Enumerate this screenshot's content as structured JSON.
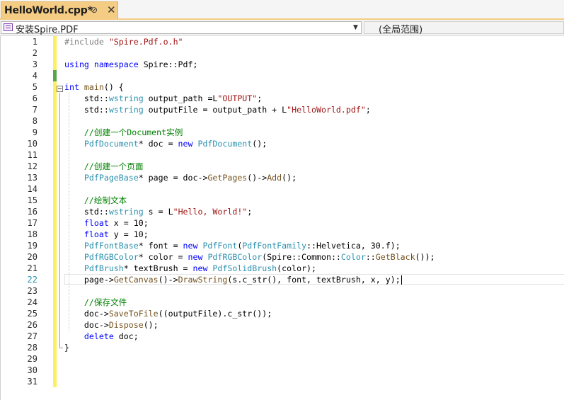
{
  "tab": {
    "title": "HelloWorld.cpp*",
    "pin_icon": "pin-icon",
    "close_icon": "close-icon"
  },
  "navbar": {
    "scope": "安装Spire.PDF",
    "member": "(全局范围)"
  },
  "editor": {
    "current_line": 22,
    "line_numbers": [
      "1",
      "2",
      "3",
      "4",
      "5",
      "6",
      "7",
      "8",
      "9",
      "10",
      "11",
      "12",
      "13",
      "14",
      "15",
      "16",
      "17",
      "18",
      "19",
      "20",
      "21",
      "22",
      "23",
      "24",
      "25",
      "26",
      "27",
      "28",
      "29",
      "30",
      "31"
    ],
    "lines": [
      [
        {
          "t": "#include ",
          "c": "pp"
        },
        {
          "t": "\"Spire.Pdf.o.h\"",
          "c": "str"
        }
      ],
      [],
      [
        {
          "t": "using namespace ",
          "c": "kw"
        },
        {
          "t": "Spire::Pdf;",
          "c": ""
        }
      ],
      [],
      [
        {
          "t": "int ",
          "c": "kw"
        },
        {
          "t": "main",
          "c": "fn"
        },
        {
          "t": "() {",
          "c": ""
        }
      ],
      [
        {
          "t": "    std::",
          "c": ""
        },
        {
          "t": "wstring",
          "c": "ty"
        },
        {
          "t": " output_path =L",
          "c": ""
        },
        {
          "t": "\"OUTPUT\"",
          "c": "str"
        },
        {
          "t": ";",
          "c": ""
        }
      ],
      [
        {
          "t": "    std::",
          "c": ""
        },
        {
          "t": "wstring",
          "c": "ty"
        },
        {
          "t": " outputFile = output_path + L",
          "c": ""
        },
        {
          "t": "\"HelloWorld.pdf\"",
          "c": "str"
        },
        {
          "t": ";",
          "c": ""
        }
      ],
      [],
      [
        {
          "t": "    //创建一个Document实例",
          "c": "cm"
        }
      ],
      [
        {
          "t": "    ",
          "c": ""
        },
        {
          "t": "PdfDocument",
          "c": "ty"
        },
        {
          "t": "* doc = ",
          "c": ""
        },
        {
          "t": "new ",
          "c": "kw"
        },
        {
          "t": "PdfDocument",
          "c": "ty"
        },
        {
          "t": "();",
          "c": ""
        }
      ],
      [],
      [
        {
          "t": "    //创建一个页面",
          "c": "cm"
        }
      ],
      [
        {
          "t": "    ",
          "c": ""
        },
        {
          "t": "PdfPageBase",
          "c": "ty"
        },
        {
          "t": "* page = doc->",
          "c": ""
        },
        {
          "t": "GetPages",
          "c": "fn"
        },
        {
          "t": "()->",
          "c": ""
        },
        {
          "t": "Add",
          "c": "fn"
        },
        {
          "t": "();",
          "c": ""
        }
      ],
      [],
      [
        {
          "t": "    //绘制文本",
          "c": "cm"
        }
      ],
      [
        {
          "t": "    std::",
          "c": ""
        },
        {
          "t": "wstring",
          "c": "ty"
        },
        {
          "t": " s = L",
          "c": ""
        },
        {
          "t": "\"Hello, World!\"",
          "c": "str"
        },
        {
          "t": ";",
          "c": ""
        }
      ],
      [
        {
          "t": "    ",
          "c": ""
        },
        {
          "t": "float",
          "c": "kw"
        },
        {
          "t": " x = 10;",
          "c": ""
        }
      ],
      [
        {
          "t": "    ",
          "c": ""
        },
        {
          "t": "float",
          "c": "kw"
        },
        {
          "t": " y = 10;",
          "c": ""
        }
      ],
      [
        {
          "t": "    ",
          "c": ""
        },
        {
          "t": "PdfFontBase",
          "c": "ty"
        },
        {
          "t": "* font = ",
          "c": ""
        },
        {
          "t": "new ",
          "c": "kw"
        },
        {
          "t": "PdfFont",
          "c": "ty"
        },
        {
          "t": "(",
          "c": ""
        },
        {
          "t": "PdfFontFamily",
          "c": "ty"
        },
        {
          "t": "::Helvetica, 30.f);",
          "c": ""
        }
      ],
      [
        {
          "t": "    ",
          "c": ""
        },
        {
          "t": "PdfRGBColor",
          "c": "ty"
        },
        {
          "t": "* color = ",
          "c": ""
        },
        {
          "t": "new ",
          "c": "kw"
        },
        {
          "t": "PdfRGBColor",
          "c": "ty"
        },
        {
          "t": "(Spire::Common::",
          "c": ""
        },
        {
          "t": "Color",
          "c": "ty"
        },
        {
          "t": "::",
          "c": ""
        },
        {
          "t": "GetBlack",
          "c": "fn"
        },
        {
          "t": "());",
          "c": ""
        }
      ],
      [
        {
          "t": "    ",
          "c": ""
        },
        {
          "t": "PdfBrush",
          "c": "ty"
        },
        {
          "t": "* textBrush = ",
          "c": ""
        },
        {
          "t": "new ",
          "c": "kw"
        },
        {
          "t": "PdfSolidBrush",
          "c": "ty"
        },
        {
          "t": "(color);",
          "c": ""
        }
      ],
      [
        {
          "t": "    page->",
          "c": ""
        },
        {
          "t": "GetCanvas",
          "c": "fn"
        },
        {
          "t": "()->",
          "c": ""
        },
        {
          "t": "DrawString",
          "c": "fn"
        },
        {
          "t": "(s.c_str(), font, textBrush, x, y);",
          "c": ""
        }
      ],
      [],
      [
        {
          "t": "    //保存文件",
          "c": "cm"
        }
      ],
      [
        {
          "t": "    doc->",
          "c": ""
        },
        {
          "t": "SaveToFile",
          "c": "fn"
        },
        {
          "t": "((outputFile).c_str());",
          "c": ""
        }
      ],
      [
        {
          "t": "    doc->",
          "c": ""
        },
        {
          "t": "Dispose",
          "c": "fn"
        },
        {
          "t": "();",
          "c": ""
        }
      ],
      [
        {
          "t": "    ",
          "c": ""
        },
        {
          "t": "delete",
          "c": "kw"
        },
        {
          "t": " doc;",
          "c": ""
        }
      ],
      [
        {
          "t": "}",
          "c": ""
        }
      ],
      [],
      [],
      []
    ]
  }
}
